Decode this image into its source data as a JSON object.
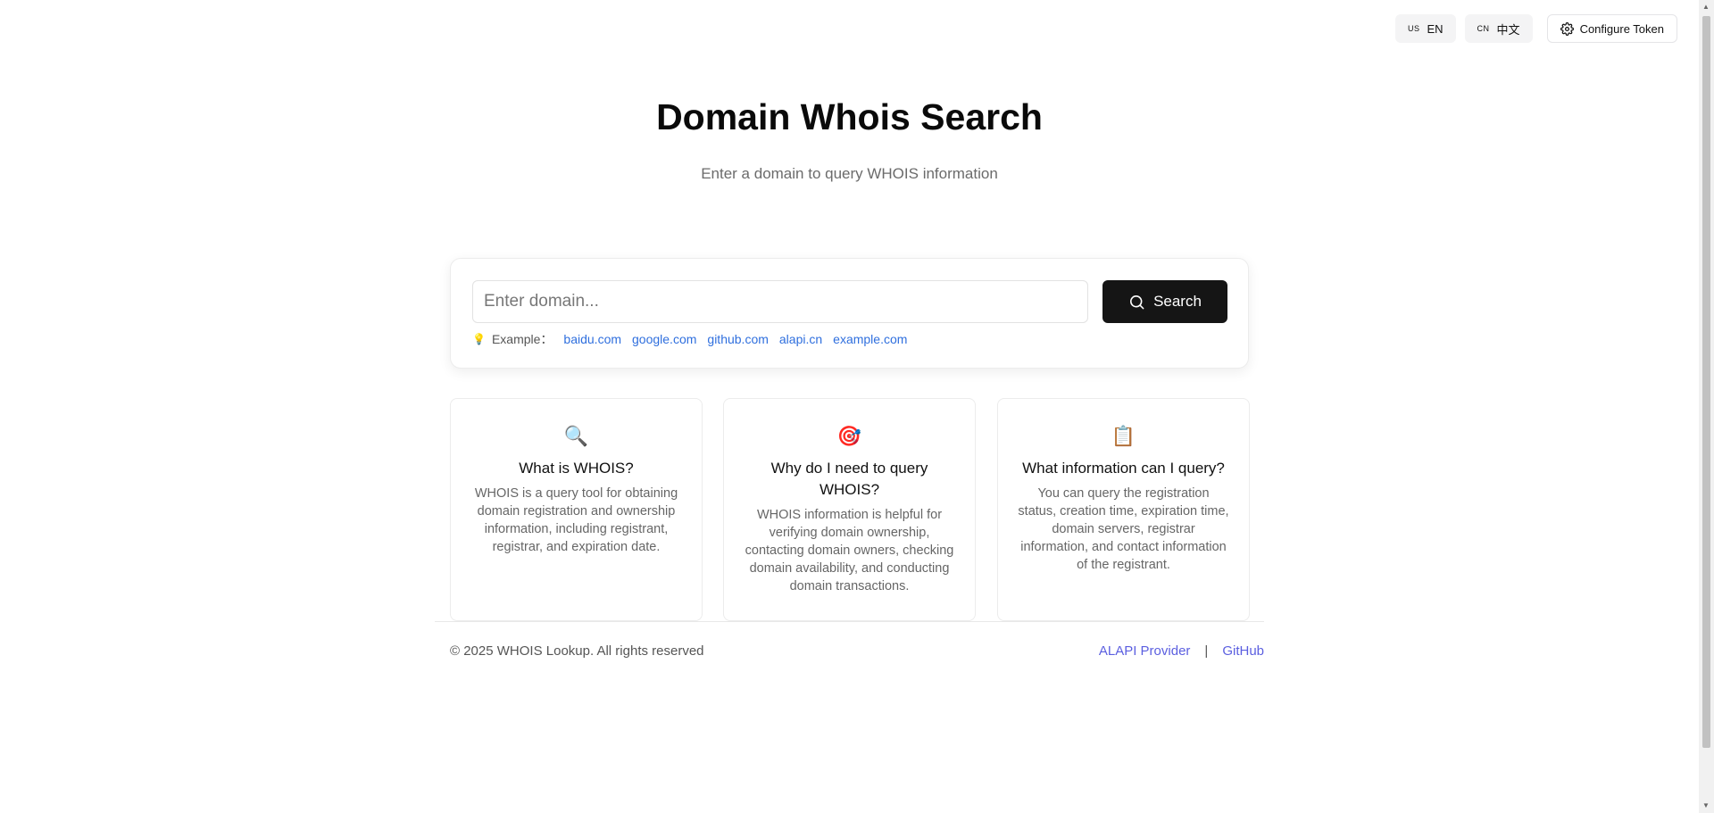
{
  "topbar": {
    "lang_en": {
      "flag": "US",
      "label": "EN"
    },
    "lang_cn": {
      "flag": "CN",
      "label": "中文"
    },
    "token_label": "Configure Token"
  },
  "hero": {
    "title": "Domain Whois Search",
    "subtitle": "Enter a domain to query WHOIS information"
  },
  "search": {
    "placeholder": "Enter domain...",
    "value": "",
    "button_label": "Search",
    "examples_label": "Example：",
    "examples": [
      "baidu.com",
      "google.com",
      "github.com",
      "alapi.cn",
      "example.com"
    ]
  },
  "cards": [
    {
      "icon": "magnifier-emoji",
      "title": "What is WHOIS?",
      "text": "WHOIS is a query tool for obtaining domain registration and ownership information, including registrant, registrar, and expiration date."
    },
    {
      "icon": "target-emoji",
      "title": "Why do I need to query WHOIS?",
      "text": "WHOIS information is helpful for verifying domain ownership, contacting domain owners, checking domain availability, and conducting domain transactions."
    },
    {
      "icon": "clipboard-emoji",
      "title": "What information can I query?",
      "text": "You can query the registration status, creation time, expiration time, domain servers, registrar information, and contact information of the registrant."
    }
  ],
  "footer": {
    "copyright": "© 2025 WHOIS Lookup. All rights reserved",
    "provider_link": "ALAPI Provider",
    "separator": "|",
    "github_link": "GitHub"
  },
  "colors": {
    "link": "#2f6fde",
    "footer_link": "#5b5fe0",
    "button_bg": "#151515"
  }
}
